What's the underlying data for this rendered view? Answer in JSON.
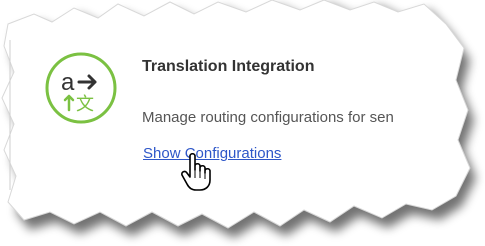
{
  "card": {
    "title": "Translation Integration",
    "description": "Manage routing configurations for sen",
    "link_label": "Show Configurations"
  },
  "icon": {
    "name": "translate-icon",
    "glyph_top": "a",
    "glyph_bottom": "↑文",
    "color": "#7bc142"
  },
  "colors": {
    "link": "#2d56c8",
    "title": "#333333",
    "description": "#555555"
  },
  "cursor": {
    "name": "hand-pointer-icon"
  }
}
